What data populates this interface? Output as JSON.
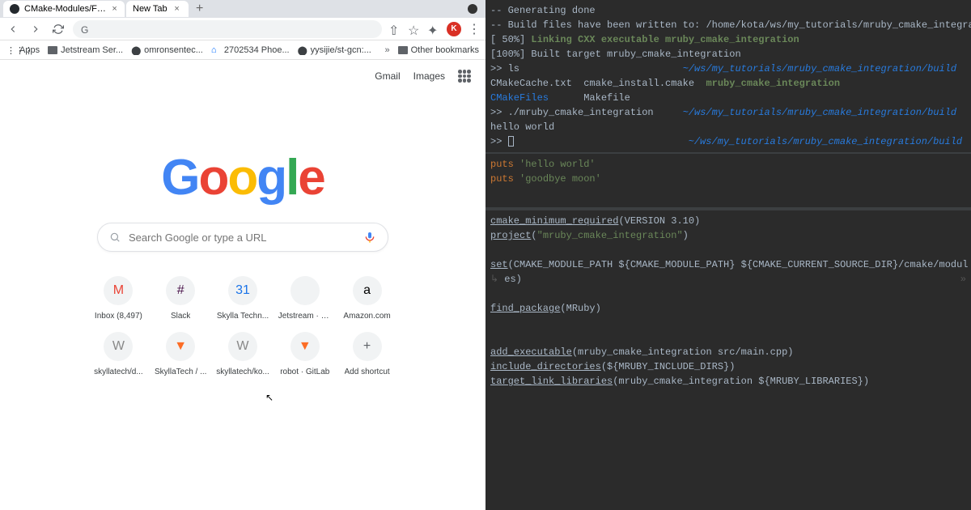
{
  "tabs": [
    {
      "title": "CMake-Modules/FindMRu...",
      "favicon": "github"
    },
    {
      "title": "New Tab",
      "favicon": ""
    }
  ],
  "address_bar": {
    "text": ""
  },
  "avatar_letter": "K",
  "bookmarks": [
    {
      "label": "Apps",
      "icon": "apps"
    },
    {
      "label": "Jetstream Ser...",
      "icon": "folder"
    },
    {
      "label": "omronsentec...",
      "icon": "github"
    },
    {
      "label": "2702534 Phoe...",
      "icon": "zillow"
    },
    {
      "label": "yysijie/st-gcn:...",
      "icon": "github"
    }
  ],
  "other_bookmarks_label": "Other bookmarks",
  "top_links": {
    "gmail": "Gmail",
    "images": "Images"
  },
  "search": {
    "placeholder": "Search Google or type a URL"
  },
  "shortcuts": [
    {
      "label": "Inbox (8,497)",
      "icon": "M",
      "color": "#ea4335"
    },
    {
      "label": "Slack",
      "icon": "#",
      "color": "#4a154b"
    },
    {
      "label": "Skylla Techn...",
      "icon": "31",
      "color": "#1a73e8"
    },
    {
      "label": "Jetstream · S...",
      "icon": "",
      "color": "#f1f3f4"
    },
    {
      "label": "Amazon.com",
      "icon": "a",
      "color": "#000"
    },
    {
      "label": "skyllatech/d...",
      "icon": "W",
      "color": "#888"
    },
    {
      "label": "SkyllaTech / ...",
      "icon": "▼",
      "color": "#fc6d26"
    },
    {
      "label": "skyllatech/ko...",
      "icon": "W",
      "color": "#888"
    },
    {
      "label": "robot · GitLab",
      "icon": "▼",
      "color": "#fc6d26"
    },
    {
      "label": "Add shortcut",
      "icon": "+",
      "color": "#5f6368"
    }
  ],
  "terminal": {
    "lines": [
      {
        "text": "-- Generating done"
      },
      {
        "text": "-- Build files have been written to: /home/kota/ws/my_tutorials/mruby_cmake_integration/build"
      },
      {
        "prefix": "[ 50%] ",
        "green": "Linking CXX executable mruby_cmake_integration"
      },
      {
        "text": "[100%] Built target mruby_cmake_integration"
      },
      {
        "prompt": ">> ls",
        "path": "~/ws/my_tutorials/mruby_cmake_integration/build"
      },
      {
        "files": "CMakeCache.txt  cmake_install.cmake  ",
        "exec": "mruby_cmake_integration"
      },
      {
        "cyan1": "CMakeFiles",
        "mid": "      Makefile"
      },
      {
        "prompt": ">> ./mruby_cmake_integration",
        "path": "~/ws/my_tutorials/mruby_cmake_integration/build"
      },
      {
        "text": "hello world"
      },
      {
        "prompt": ">> ",
        "cursor": true,
        "path": "~/ws/my_tutorials/mruby_cmake_integration/build"
      }
    ]
  },
  "ruby_code": {
    "l1_kw": "puts ",
    "l1_str": "'hello world'",
    "l2_kw": "puts ",
    "l2_str": "'goodbye moon'"
  },
  "cmake_code": {
    "l1_fn": "cmake_minimum_required",
    "l1_rest": "(VERSION 3.10)",
    "l2_fn": "project",
    "l2_p1": "(",
    "l2_str": "\"mruby_cmake_integration\"",
    "l2_p2": ")",
    "l3_fn": "set",
    "l3_rest": "(CMAKE_MODULE_PATH ${CMAKE_MODULE_PATH} ${CMAKE_CURRENT_SOURCE_DIR}/cmake/modul",
    "l3_wrap": "»",
    "l3b": "es)",
    "l3b_wrap": "↳",
    "l4_fn": "find_package",
    "l4_rest": "(MRuby)",
    "l5_fn": "add_executable",
    "l5_rest": "(mruby_cmake_integration src/main.cpp)",
    "l6_fn": "include_directories",
    "l6_rest": "(${MRUBY_INCLUDE_DIRS})",
    "l7_fn": "target_link_libraries",
    "l7_rest": "(mruby_cmake_integration ${MRUBY_LIBRARIES})"
  }
}
